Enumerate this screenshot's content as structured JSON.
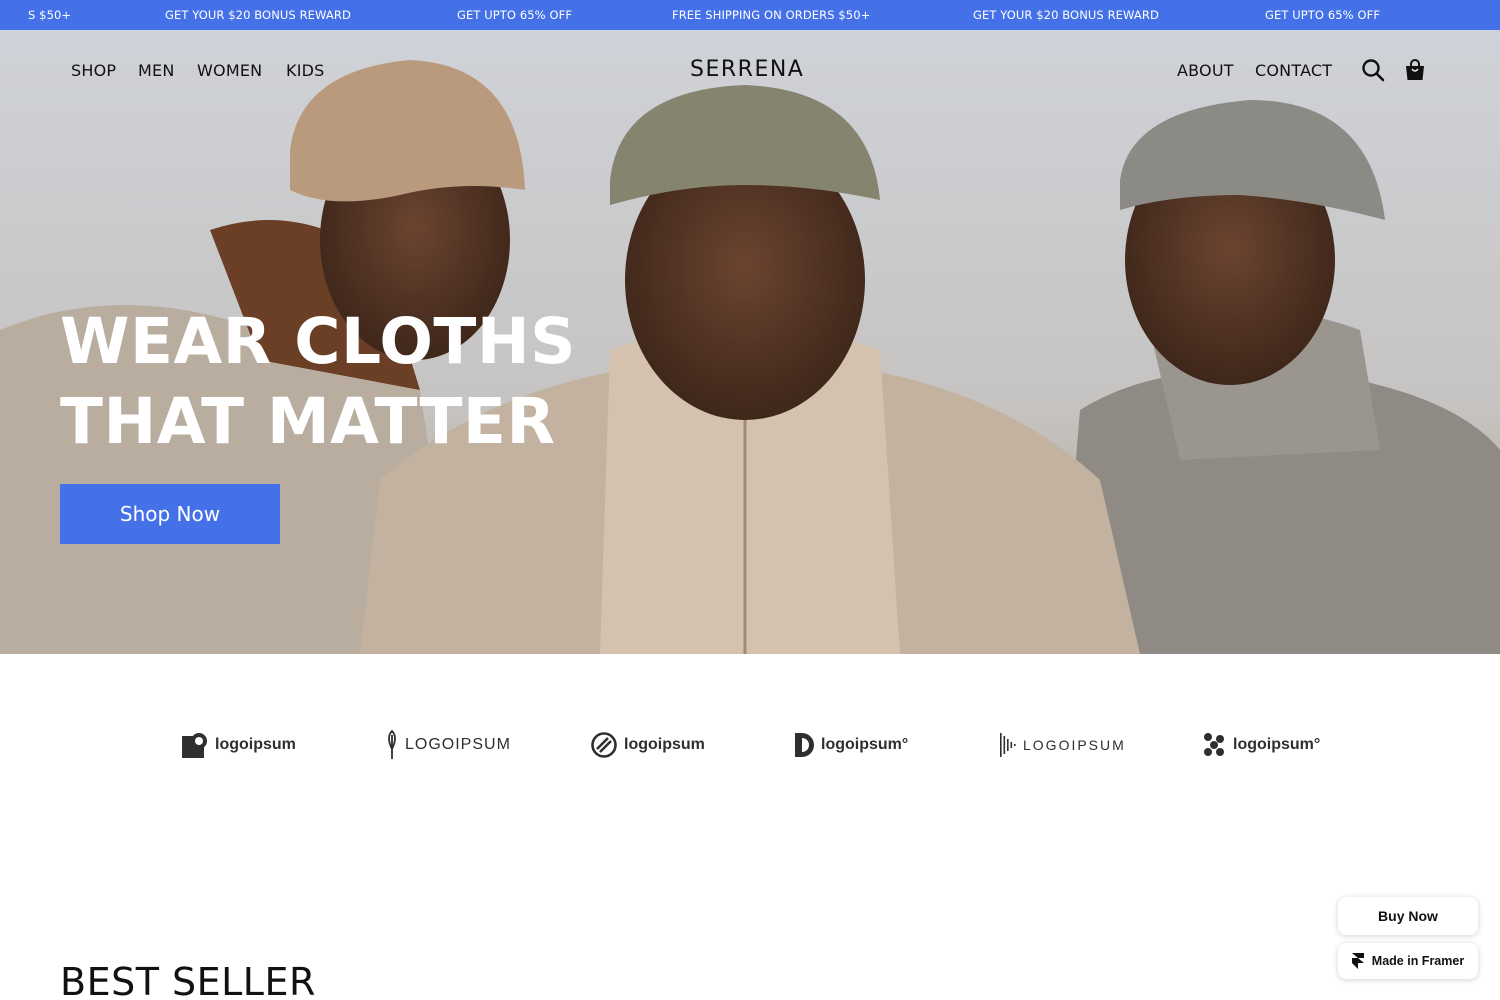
{
  "announcement": {
    "messages": [
      "S $50+",
      "GET YOUR $20 BONUS REWARD",
      "GET UPTO 65% OFF",
      "FREE SHIPPING ON ORDERS $50+",
      "GET YOUR $20 BONUS REWARD",
      "GET UPTO 65% OFF"
    ]
  },
  "nav": {
    "left": [
      "SHOP",
      "MEN",
      "WOMEN",
      "KIDS"
    ],
    "brand": "SERRENA",
    "right": [
      "ABOUT",
      "CONTACT"
    ],
    "icons": [
      "search-icon",
      "shopping-bag-icon"
    ]
  },
  "hero": {
    "headline_line1": "WEAR CLOTHS",
    "headline_line2": "THAT MATTER",
    "cta_label": "Shop Now"
  },
  "logos": [
    {
      "icon": "logo-square-icon",
      "text": "logoipsum"
    },
    {
      "icon": "logo-leaf-icon",
      "text": "LOGOIPSUM"
    },
    {
      "icon": "logo-circle-slash-icon",
      "text": "logoipsum"
    },
    {
      "icon": "logo-half-circle-icon",
      "text": "logoipsum°"
    },
    {
      "icon": "logo-bars-icon",
      "text": "LOGOIPSUM"
    },
    {
      "icon": "logo-dots-icon",
      "text": "logoipsum°"
    }
  ],
  "section": {
    "title": "BEST SELLER"
  },
  "floating": {
    "buy_now": "Buy Now",
    "made_in": "Made in Framer"
  },
  "colors": {
    "accent": "#4571e8",
    "text": "#111111",
    "background": "#ffffff"
  }
}
